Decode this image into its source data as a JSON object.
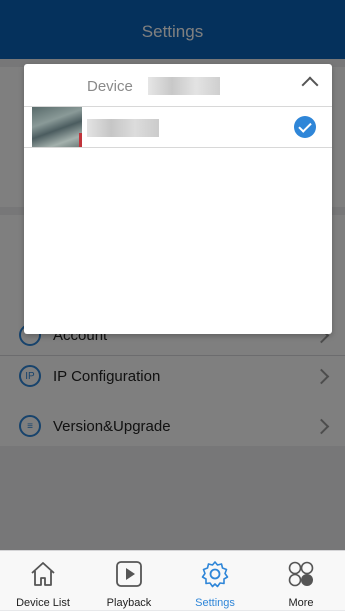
{
  "header": {
    "title": "Settings"
  },
  "settings": {
    "rows": [
      {
        "label": "Account",
        "icon": "person-icon"
      },
      {
        "label": "IP Configuration",
        "icon": "ip-icon"
      },
      {
        "label": "Version&Upgrade",
        "icon": "menu-lines-icon"
      }
    ]
  },
  "dropdown": {
    "title": "Device",
    "items": [
      {
        "checked": true,
        "thumbnail": "camera-thumbnail"
      }
    ]
  },
  "tabs": [
    {
      "label": "Device List",
      "icon": "home-icon",
      "active": false
    },
    {
      "label": "Playback",
      "icon": "play-icon",
      "active": false
    },
    {
      "label": "Settings",
      "icon": "gear-icon",
      "active": true
    },
    {
      "label": "More",
      "icon": "more-icon",
      "active": false
    }
  ],
  "colors": {
    "primary": "#0b63b8",
    "accent": "#2f86d8"
  }
}
